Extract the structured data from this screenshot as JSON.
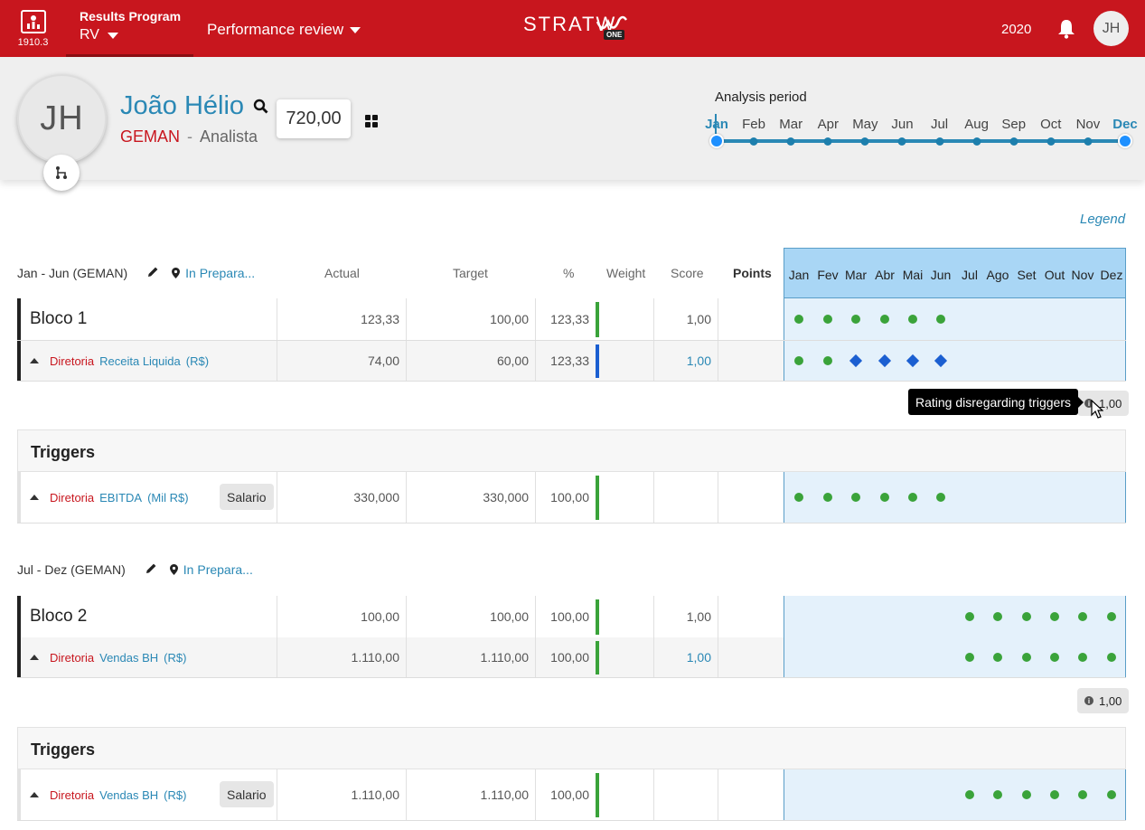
{
  "topbar": {
    "app_version": "1910.3",
    "program_title": "Results Program",
    "program_value": "RV",
    "menu_label": "Performance review",
    "logo_text": "STRATW",
    "logo_badge": "ONE",
    "year": "2020",
    "user_initials": "JH"
  },
  "profile": {
    "initials": "JH",
    "name": "João Hélio",
    "department": "GEMAN",
    "separator": "-",
    "role": "Analista",
    "score": "720,00"
  },
  "analysis_period": {
    "title": "Analysis period",
    "months": [
      "Jan",
      "Feb",
      "Mar",
      "Apr",
      "May",
      "Jun",
      "Jul",
      "Aug",
      "Sep",
      "Oct",
      "Nov",
      "Dec"
    ],
    "selected_start": "Jan",
    "selected_end": "Dec"
  },
  "legend_label": "Legend",
  "columns": {
    "actual": "Actual",
    "target": "Target",
    "percent": "%",
    "weight": "Weight",
    "score": "Score",
    "points": "Points",
    "months": [
      "Jan",
      "Fev",
      "Mar",
      "Abr",
      "Mai",
      "Jun",
      "Jul",
      "Ago",
      "Set",
      "Out",
      "Nov",
      "Dez"
    ]
  },
  "sections": [
    {
      "title": "Jan - Jun (GEMAN)",
      "status": "In Prepara...",
      "block": {
        "name": "Bloco 1",
        "actual": "123,33",
        "target": "100,00",
        "percent": "123,33",
        "score": "1,00",
        "markers": [
          "green",
          "green",
          "green",
          "green",
          "green",
          "green",
          "",
          "",
          "",
          "",
          "",
          ""
        ]
      },
      "kpi": {
        "dir": "Diretoria",
        "name": "Receita Liquida",
        "unit": "(R$)",
        "actual": "74,00",
        "target": "60,00",
        "percent": "123,33",
        "score": "1,00",
        "markers": [
          "green",
          "green",
          "blue",
          "blue",
          "blue",
          "blue",
          "",
          "",
          "",
          "",
          "",
          ""
        ]
      },
      "result_score": "1,00",
      "tooltip": "Rating disregarding triggers",
      "triggers_title": "Triggers",
      "trigger": {
        "dir": "Diretoria",
        "name": "EBITDA",
        "unit": "(Mil R$)",
        "tag": "Salario",
        "actual": "330,000",
        "target": "330,000",
        "percent": "100,00",
        "markers": [
          "green",
          "green",
          "green",
          "green",
          "green",
          "green",
          "",
          "",
          "",
          "",
          "",
          ""
        ]
      }
    },
    {
      "title": "Jul - Dez (GEMAN)",
      "status": "In Prepara...",
      "block": {
        "name": "Bloco 2",
        "actual": "100,00",
        "target": "100,00",
        "percent": "100,00",
        "score": "1,00",
        "markers": [
          "",
          "",
          "",
          "",
          "",
          "",
          "green",
          "green",
          "green",
          "green",
          "green",
          "green"
        ]
      },
      "kpi": {
        "dir": "Diretoria",
        "name": "Vendas BH",
        "unit": "(R$)",
        "actual": "1.110,00",
        "target": "1.110,00",
        "percent": "100,00",
        "score": "1,00",
        "markers": [
          "",
          "",
          "",
          "",
          "",
          "",
          "green",
          "green",
          "green",
          "green",
          "green",
          "green"
        ]
      },
      "result_score": "1,00",
      "triggers_title": "Triggers",
      "trigger": {
        "dir": "Diretoria",
        "name": "Vendas BH",
        "unit": "(R$)",
        "tag": "Salario",
        "actual": "1.110,00",
        "target": "1.110,00",
        "percent": "100,00",
        "markers": [
          "",
          "",
          "",
          "",
          "",
          "",
          "green",
          "green",
          "green",
          "green",
          "green",
          "green"
        ]
      }
    }
  ],
  "colors": {
    "brand_red": "#c8161e",
    "accent_blue": "#2a88b5",
    "ok_green": "#3aa33a",
    "warn_blue": "#1b5fd1"
  }
}
